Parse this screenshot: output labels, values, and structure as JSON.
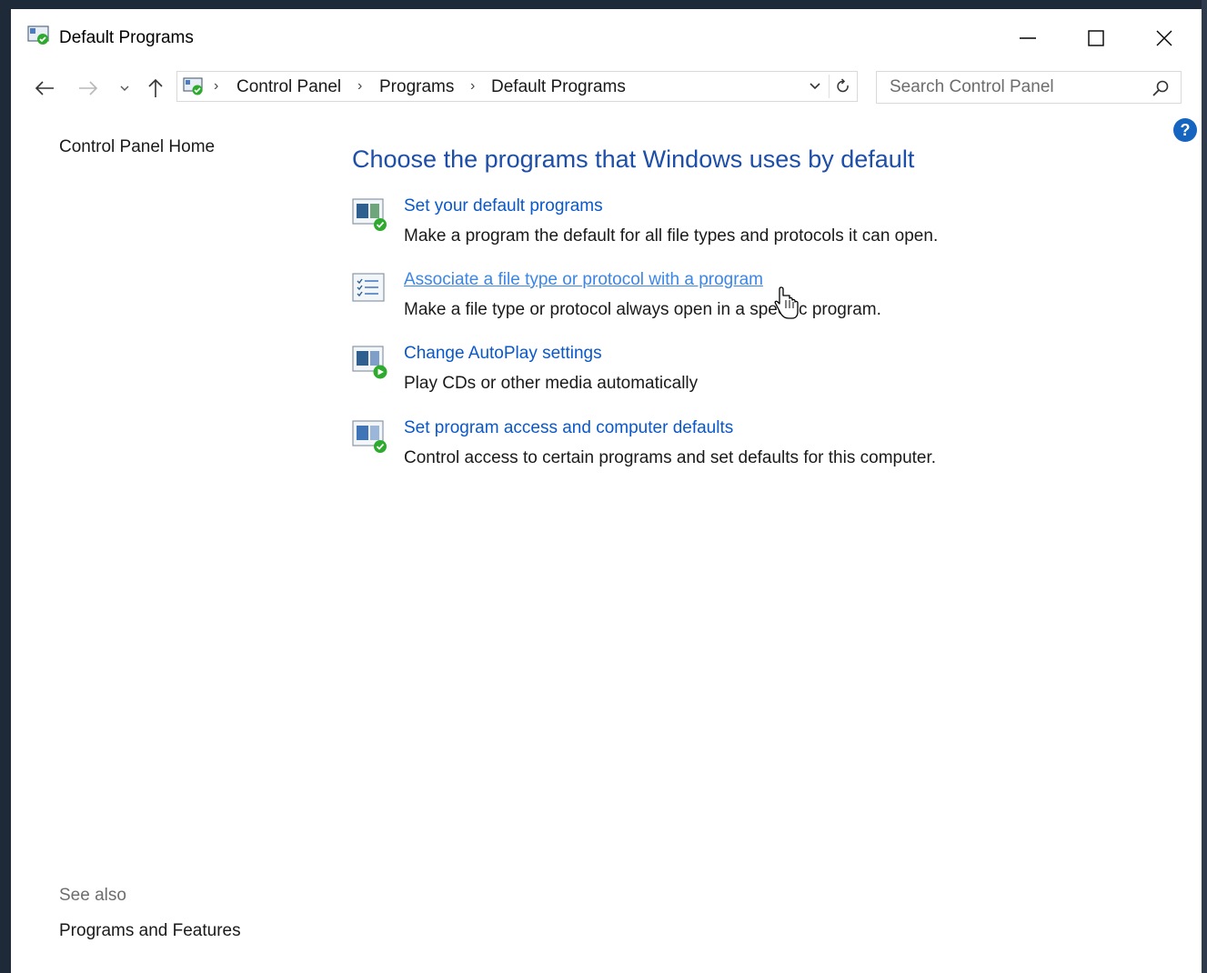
{
  "window": {
    "title": "Default Programs"
  },
  "navigation": {
    "breadcrumbs": [
      "Control Panel",
      "Programs",
      "Default Programs"
    ],
    "search_placeholder": "Search Control Panel"
  },
  "sidebar": {
    "home_label": "Control Panel Home",
    "see_also_label": "See also",
    "see_also_items": [
      "Programs and Features"
    ]
  },
  "main": {
    "heading": "Choose the programs that Windows uses by default",
    "tasks": [
      {
        "link": "Set your default programs",
        "description": "Make a program the default for all file types and protocols it can open.",
        "icon": "default-programs-icon"
      },
      {
        "link": "Associate a file type or protocol with a program",
        "description": "Make a file type or protocol always open in a specific program.",
        "icon": "file-association-icon"
      },
      {
        "link": "Change AutoPlay settings",
        "description": "Play CDs or other media automatically",
        "icon": "autoplay-icon"
      },
      {
        "link": "Set program access and computer defaults",
        "description": "Control access to certain programs and set defaults for this computer.",
        "icon": "program-access-icon"
      }
    ]
  },
  "colors": {
    "heading": "#1e4fa8",
    "link": "#0a58ca",
    "link_hover": "#3a86e8",
    "help_badge": "#1565c0",
    "check_green": "#2eaa2e"
  }
}
